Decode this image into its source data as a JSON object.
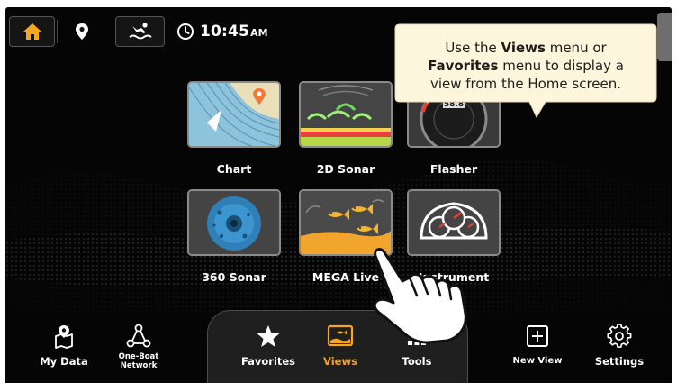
{
  "status_bar": {
    "clock_time": "10:45",
    "clock_ampm": "AM",
    "icons": [
      "home-icon",
      "location-pin-icon",
      "person-overboard-icon",
      "clock-icon"
    ]
  },
  "callout": {
    "prefix": "Use the ",
    "views": "Views",
    "middle": " menu or",
    "favorites": "Favorites",
    "line2_suffix": " menu to display a",
    "line3": "view from the Home screen."
  },
  "views": [
    {
      "label": "Chart"
    },
    {
      "label": "2D Sonar"
    },
    {
      "label": "Flasher"
    },
    {
      "label": "360 Sonar"
    },
    {
      "label": "MEGA Live"
    },
    {
      "label": "Instrument"
    }
  ],
  "nav": {
    "my_data": "My Data",
    "one_boat_1": "One-Boat",
    "one_boat_2": "Network",
    "favorites": "Favorites",
    "views": "Views",
    "tools": "Tools",
    "new_view": "New View",
    "settings": "Settings"
  },
  "colors": {
    "accent": "#f5a623",
    "screen_bg": "#050505",
    "callout_bg": "#fdf6dc"
  }
}
